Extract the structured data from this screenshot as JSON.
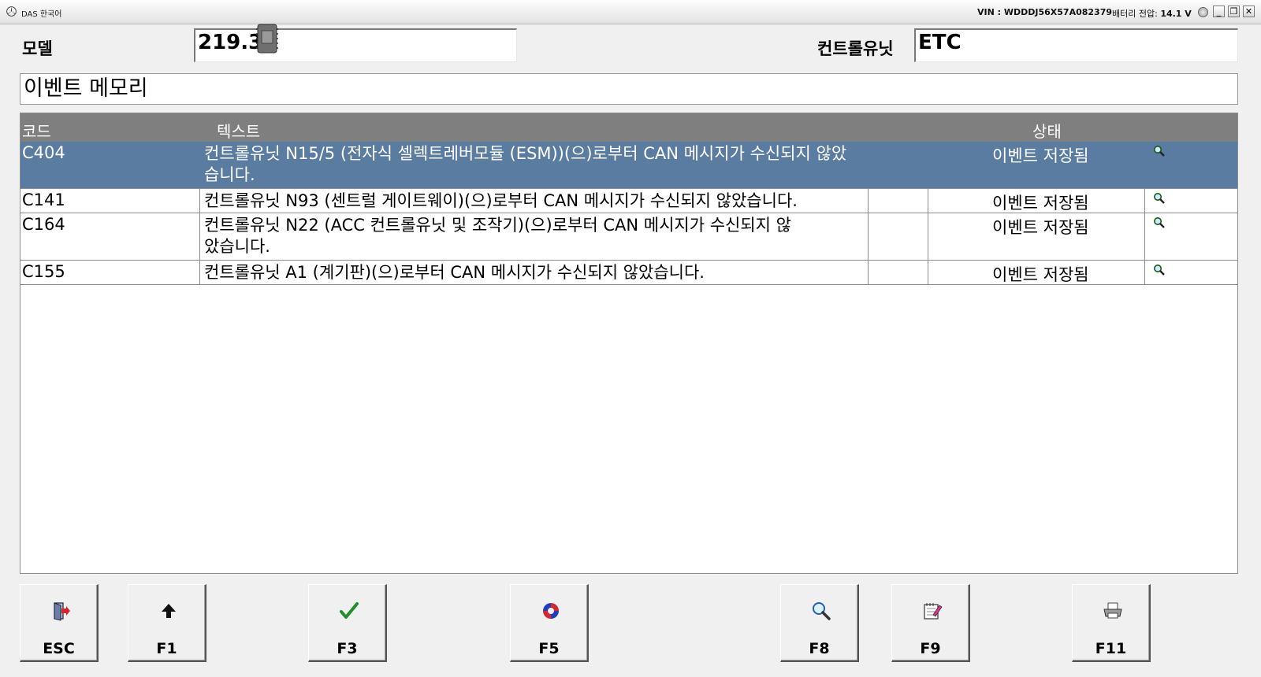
{
  "window": {
    "app_title": "DAS 한국어",
    "vin": "VIN : WDDDJ56X57A082379",
    "battery_label": "배터리 전압: ",
    "battery_value": "14.1 V",
    "buttons": {
      "minimize": "_",
      "restore": "❐",
      "close": "✕"
    }
  },
  "header": {
    "model_label": "모델",
    "model_value": "219.3",
    "control_unit_label": "컨트롤유닛",
    "control_unit_value": "ETC",
    "section_title": "이벤트 메모리"
  },
  "table": {
    "columns": {
      "code": "코드",
      "text": "텍스트",
      "status": "상태"
    },
    "rows": [
      {
        "code": "C404",
        "text": "컨트롤유닛 N15/5 (전자식 셀렉트레버모듈 (ESM))(으)로부터 CAN 메시지가 수신되지 않았습니다.",
        "status": "이벤트 저장됨",
        "selected": true
      },
      {
        "code": "C141",
        "text": "컨트롤유닛 N93 (센트럴 게이트웨이)(으)로부터 CAN 메시지가 수신되지 않았습니다.",
        "status": "이벤트 저장됨"
      },
      {
        "code": "C164",
        "text": "컨트롤유닛 N22 (ACC 컨트롤유닛 및 조작기)(으)로부터 CAN 메시지가 수신되지 않았습니다.",
        "status": "이벤트 저장됨"
      },
      {
        "code": "C155",
        "text": "컨트롤유닛 A1 (계기판)(으)로부터 CAN 메시지가 수신되지 않았습니다.",
        "status": "이벤트 저장됨"
      }
    ],
    "row_icon": "magnifier-icon"
  },
  "function_keys": [
    {
      "label": "ESC",
      "icon": "exit-door-icon"
    },
    {
      "label": "F1",
      "icon": "arrow-up-icon"
    },
    {
      "label": "F3",
      "icon": "checkmark-icon"
    },
    {
      "label": "F5",
      "icon": "refresh-circle-icon"
    },
    {
      "label": "F8",
      "icon": "magnifier-icon"
    },
    {
      "label": "F9",
      "icon": "notepad-icon"
    },
    {
      "label": "F11",
      "icon": "printer-icon"
    }
  ],
  "colors": {
    "selected_row": "#5a7ca1",
    "header_bar": "#7f7f7f"
  }
}
